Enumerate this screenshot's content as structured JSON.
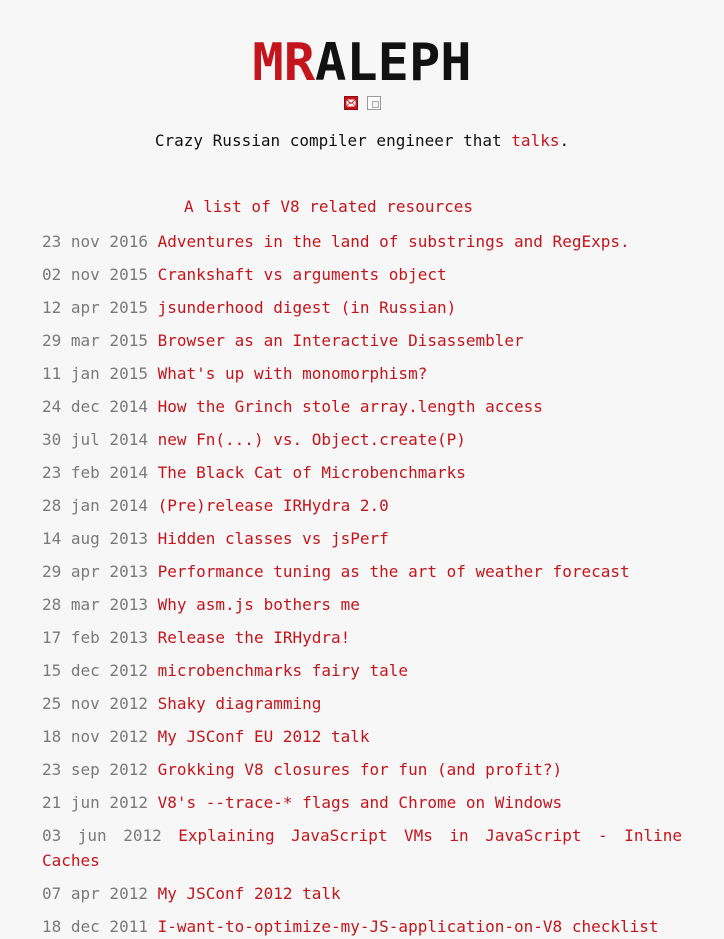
{
  "header": {
    "logo_red": "MR",
    "logo_black": "ALEPH",
    "icons": [
      "mail-icon",
      "page-icon"
    ]
  },
  "tagline": {
    "prefix": "Crazy Russian compiler engineer that ",
    "link": "talks",
    "suffix": "."
  },
  "resources_link": "A list of V8 related resources",
  "posts": [
    {
      "date": "23 nov 2016",
      "title": "Adventures in the land of substrings and RegExps."
    },
    {
      "date": "02 nov 2015",
      "title": "Crankshaft vs arguments object"
    },
    {
      "date": "12 apr 2015",
      "title": "jsunderhood digest (in Russian)"
    },
    {
      "date": "29 mar 2015",
      "title": "Browser as an Interactive Disassembler"
    },
    {
      "date": "11 jan 2015",
      "title": "What's up with monomorphism?"
    },
    {
      "date": "24 dec 2014",
      "title": "How the Grinch stole array.length access"
    },
    {
      "date": "30 jul 2014",
      "title": "new Fn(...) vs. Object.create(P)"
    },
    {
      "date": "23 feb 2014",
      "title": "The Black Cat of Microbenchmarks"
    },
    {
      "date": "28 jan 2014",
      "title": "(Pre)release IRHydra 2.0"
    },
    {
      "date": "14 aug 2013",
      "title": "Hidden classes vs jsPerf"
    },
    {
      "date": "29 apr 2013",
      "title": "Performance tuning as the art of weather forecast"
    },
    {
      "date": "28 mar 2013",
      "title": "Why asm.js bothers me"
    },
    {
      "date": "17 feb 2013",
      "title": "Release the IRHydra!"
    },
    {
      "date": "15 dec 2012",
      "title": "microbenchmarks fairy tale"
    },
    {
      "date": "25 nov 2012",
      "title": "Shaky diagramming"
    },
    {
      "date": "18 nov 2012",
      "title": "My JSConf EU 2012 talk"
    },
    {
      "date": "23 sep 2012",
      "title": "Grokking V8 closures for fun (and profit?)"
    },
    {
      "date": "21 jun 2012",
      "title": "V8's --trace-* flags and Chrome on Windows"
    },
    {
      "date": "03 jun 2012",
      "title": "Explaining JavaScript VMs in JavaScript - Inline Caches"
    },
    {
      "date": "07 apr 2012",
      "title": "My JSConf 2012 talk"
    },
    {
      "date": "18 dec 2011",
      "title": "I-want-to-optimize-my-JS-application-on-V8 checklist"
    }
  ]
}
